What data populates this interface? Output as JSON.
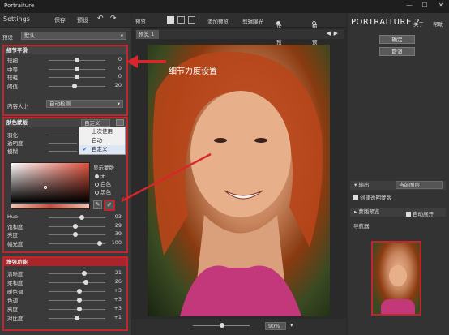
{
  "window": {
    "title": "Portraiture",
    "controls": [
      "—",
      "☐",
      "✕"
    ]
  },
  "left_toolbar": {
    "settings": "Settings",
    "save": "保存",
    "preset": "预设",
    "undo": "↶",
    "redo": "↷"
  },
  "preset": {
    "label": "预设",
    "value": "默认"
  },
  "detail": {
    "title": "细节平滑",
    "rows": [
      {
        "label": "较细",
        "value": "0",
        "pos": 0.5
      },
      {
        "label": "中等",
        "value": "0",
        "pos": 0.5
      },
      {
        "label": "较粗",
        "value": "0",
        "pos": 0.5
      },
      {
        "label": "阈值",
        "value": "20",
        "pos": 0.45
      }
    ],
    "size_label": "内容大小",
    "size_value": "自动检测"
  },
  "skin": {
    "title": "肤色蒙版",
    "mode_value": "自定义",
    "rows": [
      {
        "label": "羽化"
      },
      {
        "label": "透明度"
      },
      {
        "label": "模糊"
      }
    ],
    "show_mask_label": "显示蒙版",
    "options": [
      "无",
      "白色",
      "黑色"
    ],
    "sliders": [
      {
        "label": "Hue",
        "value": "93",
        "pos": 0.55
      },
      {
        "label": "饱和度",
        "value": "29",
        "pos": 0.45
      },
      {
        "label": "亮度",
        "value": "39",
        "pos": 0.45
      },
      {
        "label": "幅光度",
        "value": "100",
        "pos": 0.9
      }
    ]
  },
  "dropdown_menu": {
    "items": [
      "上次使用",
      "自动",
      "自定义"
    ],
    "checked_index": 2
  },
  "enhance": {
    "title": "增强功能",
    "rows": [
      {
        "label": "清晰度",
        "value": "21",
        "pos": 0.62
      },
      {
        "label": "柔和度",
        "value": "26",
        "pos": 0.65
      },
      {
        "label": "暖色调",
        "value": "+3",
        "pos": 0.52
      },
      {
        "label": "色调",
        "value": "+3",
        "pos": 0.52
      },
      {
        "label": "亮度",
        "value": "+3",
        "pos": 0.52
      },
      {
        "label": "对比度",
        "value": "+1",
        "pos": 0.5
      }
    ]
  },
  "center_toolbar": {
    "preview": "预览",
    "add_preview": "添加预览",
    "clip_exposure": "剪辑曝光",
    "quick_preview": "快速预览",
    "precise_preview": "精确预览"
  },
  "preview_tab": "预览 1",
  "zoom": {
    "value": "90%"
  },
  "annotation": {
    "text": "细节力度设置"
  },
  "right": {
    "logo": "PORTRAITURE 2",
    "about": "关于",
    "help": "帮助",
    "ok": "确定",
    "cancel": "取消",
    "output_label": "输出",
    "output_value": "当前图层",
    "new_layer": "创建透明蒙版",
    "mask_preview": "蒙版预览",
    "auto_expand": "自动展开",
    "navigator": "导航器"
  },
  "colors": {
    "accent_red": "#c0262b",
    "panel": "#3a3a3a"
  }
}
